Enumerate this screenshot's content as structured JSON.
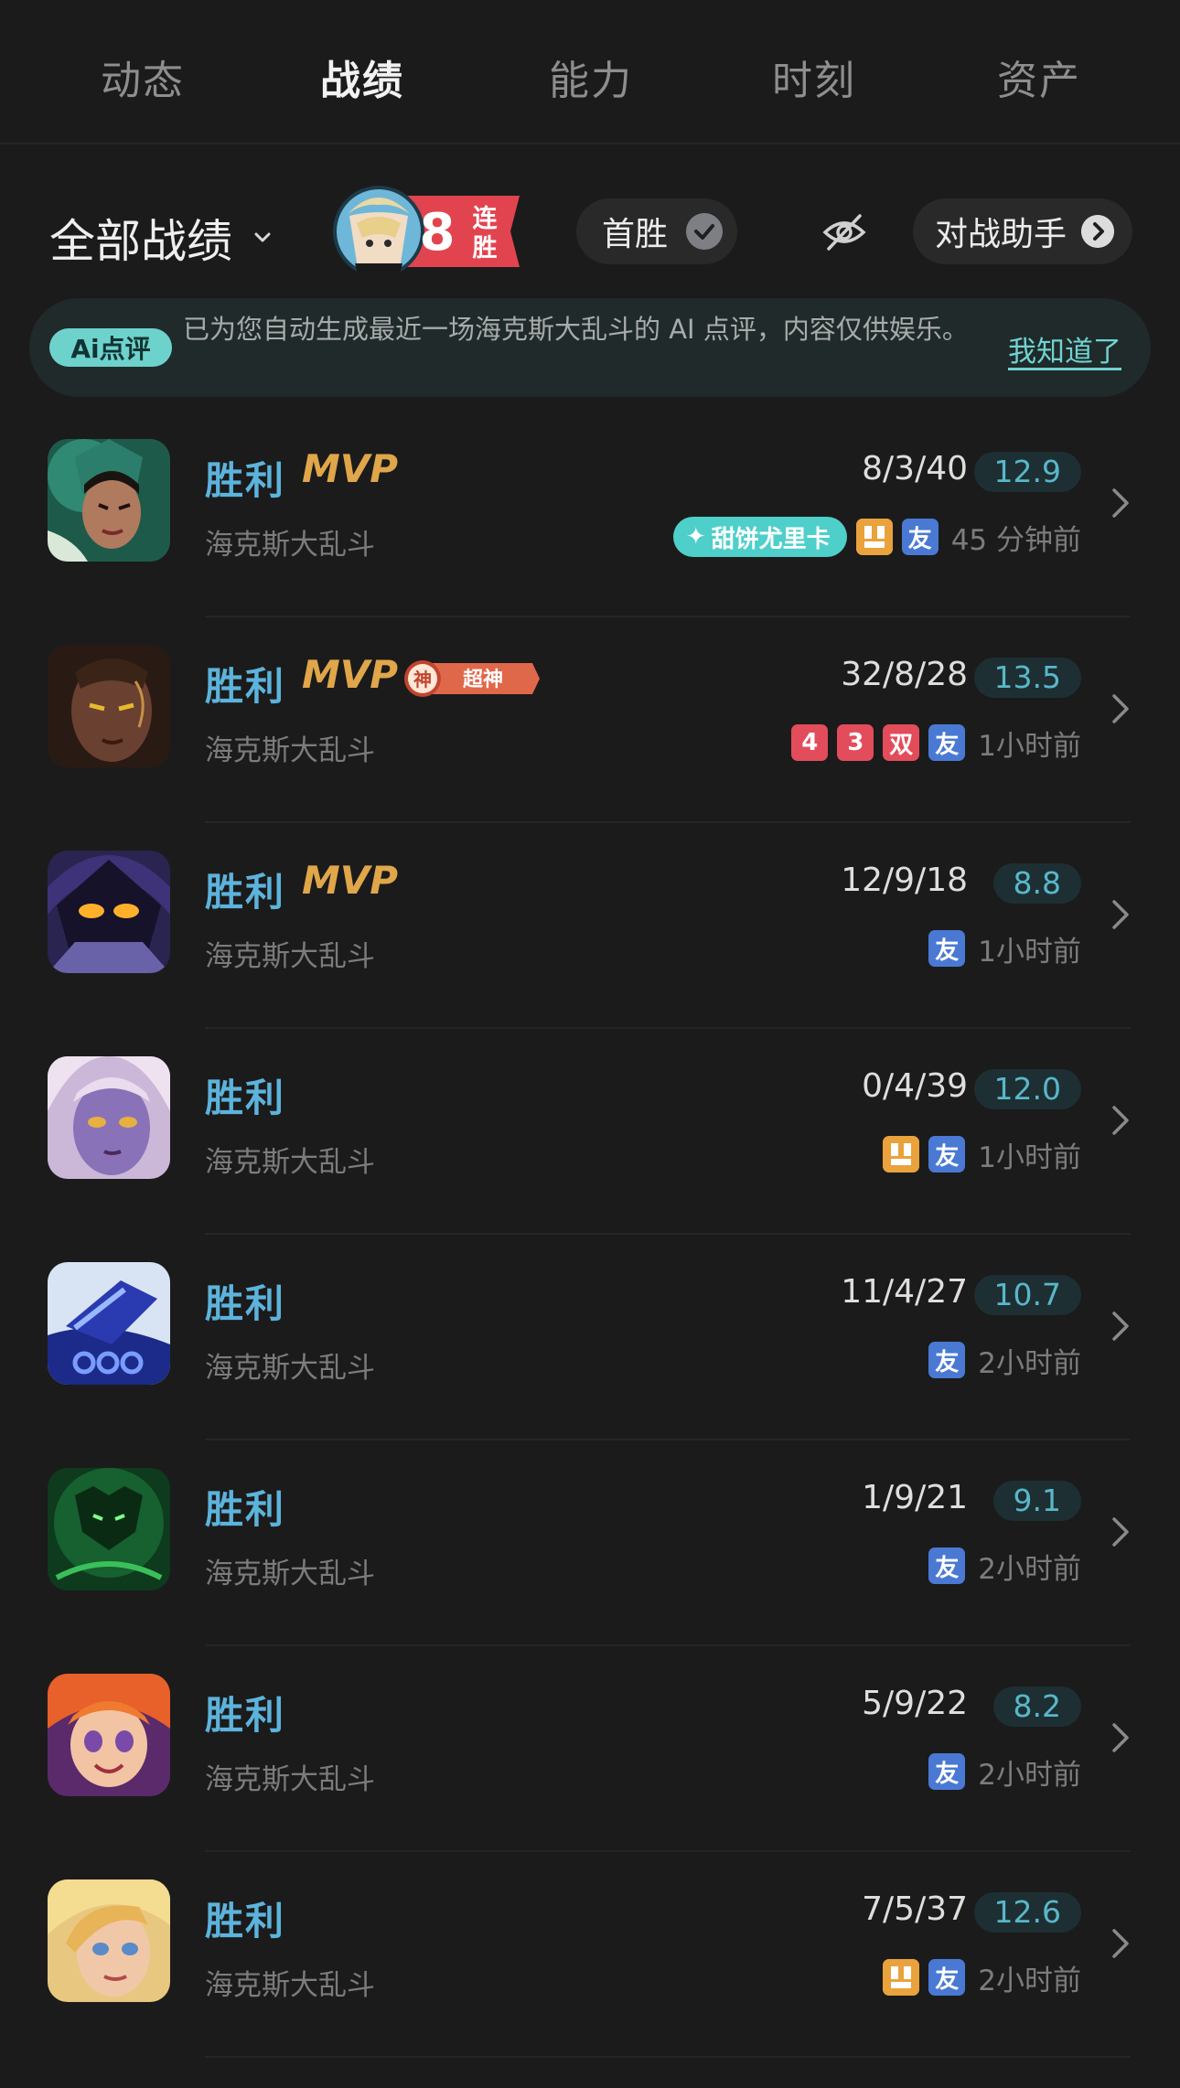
{
  "tabs": [
    "动态",
    "战绩",
    "能力",
    "时刻",
    "资产"
  ],
  "filter": {
    "all_records": "全部战绩",
    "streak_number": "8",
    "streak_label_1": "连",
    "streak_label_2": "胜",
    "first_win": "首胜",
    "assistant": "对战助手"
  },
  "ai_banner": {
    "badge": "Ai点评",
    "text": "已为您自动生成最近一场海克斯大乱斗的 AI 点评，内容仅供娱乐。",
    "ok": "我知道了"
  },
  "colors": {
    "result": "#5cb3dc",
    "mvp": "#e0a64a",
    "score_text": "#58b7c9",
    "friend_tag": "#4a79d4"
  },
  "matches": [
    {
      "result": "胜利",
      "mvp": "MVP",
      "mode": "海克斯大乱斗",
      "kda": "8/3/40",
      "score": "12.9",
      "special": "甜饼尤里卡",
      "tags": [
        "orange",
        "friend"
      ],
      "time": "45 分钟前"
    },
    {
      "result": "胜利",
      "mvp": "MVP",
      "god_badge_1": "神",
      "god_badge_2": "超神",
      "mode": "海克斯大乱斗",
      "kda": "32/8/28",
      "score": "13.5",
      "multikill": [
        "4",
        "3",
        "双"
      ],
      "tags": [
        "friend"
      ],
      "time": "1小时前"
    },
    {
      "result": "胜利",
      "mvp": "MVP",
      "mode": "海克斯大乱斗",
      "kda": "12/9/18",
      "score": "8.8",
      "tags": [
        "friend"
      ],
      "time": "1小时前"
    },
    {
      "result": "胜利",
      "mode": "海克斯大乱斗",
      "kda": "0/4/39",
      "score": "12.0",
      "tags": [
        "orange",
        "friend"
      ],
      "time": "1小时前"
    },
    {
      "result": "胜利",
      "mode": "海克斯大乱斗",
      "kda": "11/4/27",
      "score": "10.7",
      "tags": [
        "friend"
      ],
      "time": "2小时前"
    },
    {
      "result": "胜利",
      "mode": "海克斯大乱斗",
      "kda": "1/9/21",
      "score": "9.1",
      "tags": [
        "friend"
      ],
      "time": "2小时前"
    },
    {
      "result": "胜利",
      "mode": "海克斯大乱斗",
      "kda": "5/9/22",
      "score": "8.2",
      "tags": [
        "friend"
      ],
      "time": "2小时前"
    },
    {
      "result": "胜利",
      "mode": "海克斯大乱斗",
      "kda": "7/5/37",
      "score": "12.6",
      "tags": [
        "orange",
        "friend"
      ],
      "time": "2小时前"
    }
  ],
  "friend_label": "友"
}
